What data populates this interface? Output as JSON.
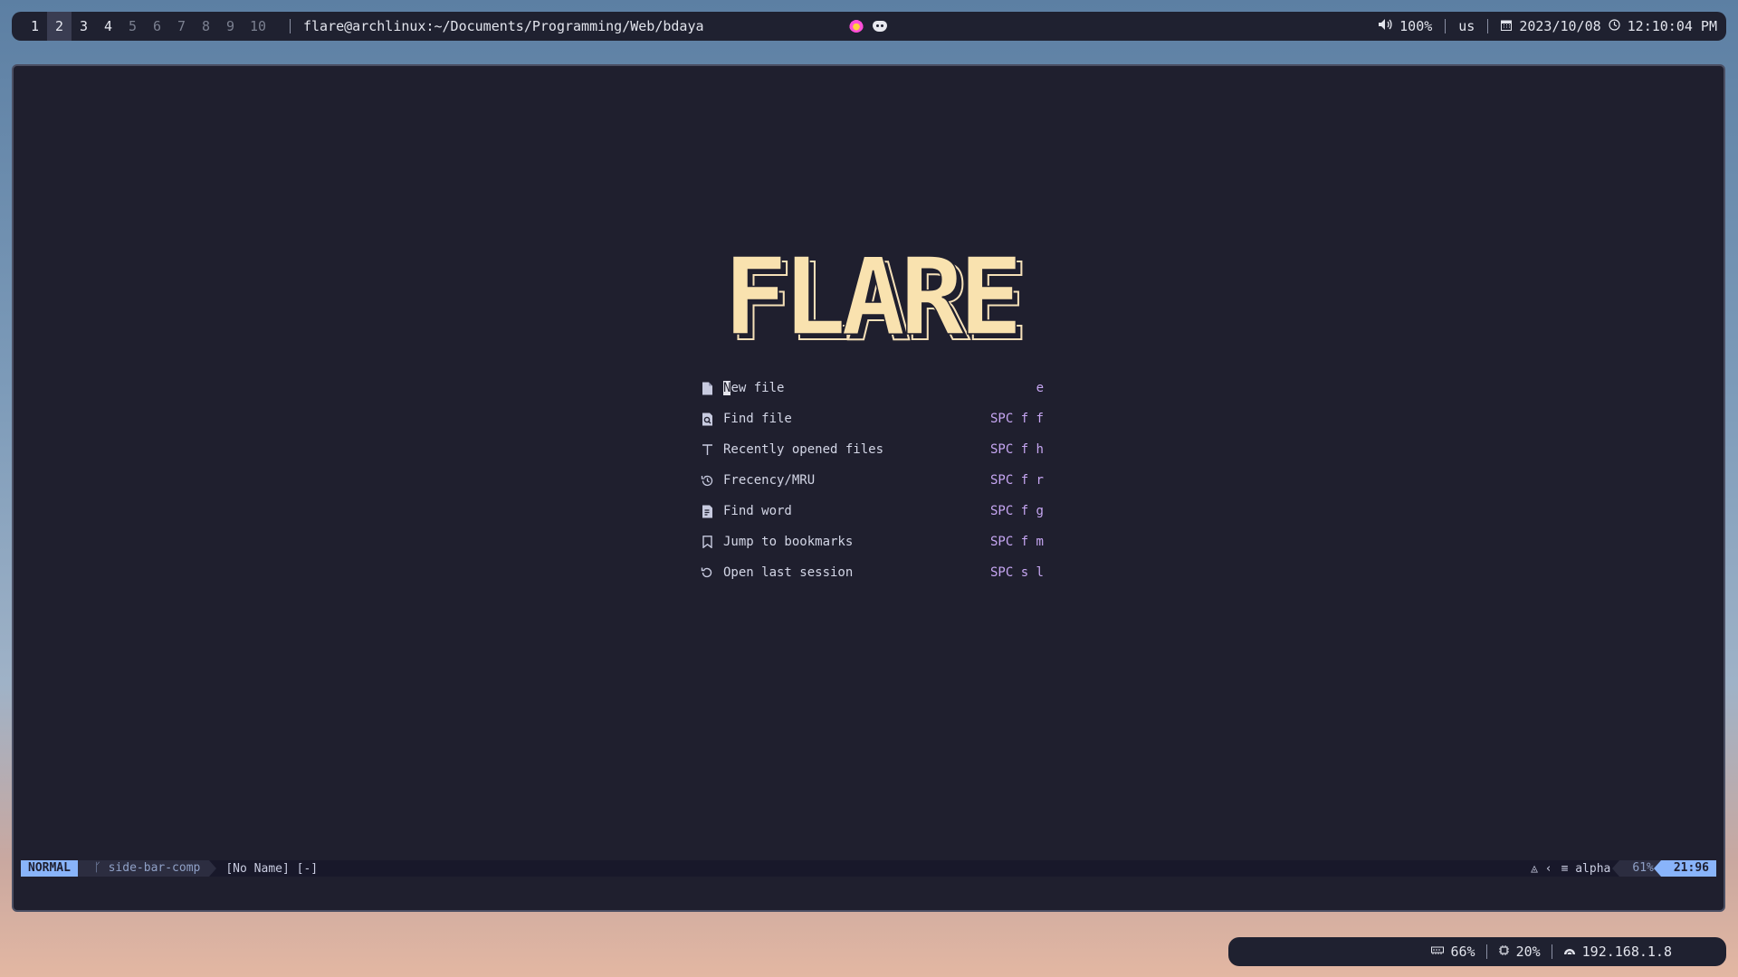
{
  "topbar": {
    "workspaces": [
      "1",
      "2",
      "3",
      "4",
      "5",
      "6",
      "7",
      "8",
      "9",
      "10"
    ],
    "window_title": "flare@archlinux:~/Documents/Programming/Web/bdaya",
    "volume": "100%",
    "layout": "us",
    "date": "2023/10/08",
    "time": "12:10:04 PM"
  },
  "dashboard": {
    "logo_text": "FLARE",
    "menu": [
      {
        "icon": "file-icon",
        "label": "New file",
        "shortcut": "e"
      },
      {
        "icon": "find-file-icon",
        "label": "Find file",
        "shortcut": "SPC f f"
      },
      {
        "icon": "recent-icon",
        "label": "Recently opened files",
        "shortcut": "SPC f h"
      },
      {
        "icon": "history-icon",
        "label": "Frecency/MRU",
        "shortcut": "SPC f r"
      },
      {
        "icon": "find-word-icon",
        "label": "Find word",
        "shortcut": "SPC f g"
      },
      {
        "icon": "bookmark-icon",
        "label": "Jump to bookmarks",
        "shortcut": "SPC f m"
      },
      {
        "icon": "session-icon",
        "label": "Open last session",
        "shortcut": "SPC s l"
      }
    ]
  },
  "statusline": {
    "mode": "NORMAL",
    "branch": "side-bar-comp",
    "file": "[No Name] [-]",
    "filetype": "alpha",
    "percent": "61%",
    "position": "21:96"
  },
  "bottombar": {
    "memory": "66%",
    "cpu": "20%",
    "ip": "192.168.1.8"
  }
}
